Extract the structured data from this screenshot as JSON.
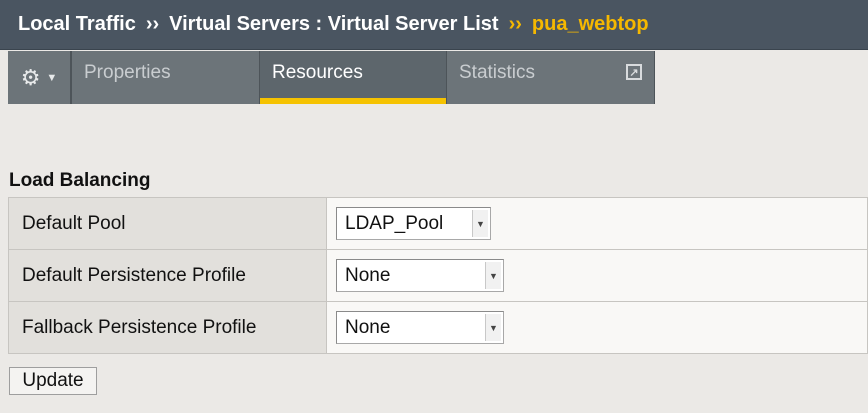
{
  "breadcrumb": {
    "item1": "Local Traffic",
    "sep": "››",
    "item2": "Virtual Servers : Virtual Server List",
    "current": "pua_webtop"
  },
  "tabs": {
    "properties": "Properties",
    "resources": "Resources",
    "statistics": "Statistics",
    "gear_icon": "gear-icon"
  },
  "section": {
    "title": "Load Balancing"
  },
  "form": {
    "rows": [
      {
        "label": "Default Pool",
        "value": "LDAP_Pool"
      },
      {
        "label": "Default Persistence Profile",
        "value": "None"
      },
      {
        "label": "Fallback Persistence Profile",
        "value": "None"
      }
    ]
  },
  "actions": {
    "update": "Update"
  },
  "colors": {
    "accent": "#f5c200",
    "header": "#4a5561",
    "tab": "#6c7479"
  }
}
